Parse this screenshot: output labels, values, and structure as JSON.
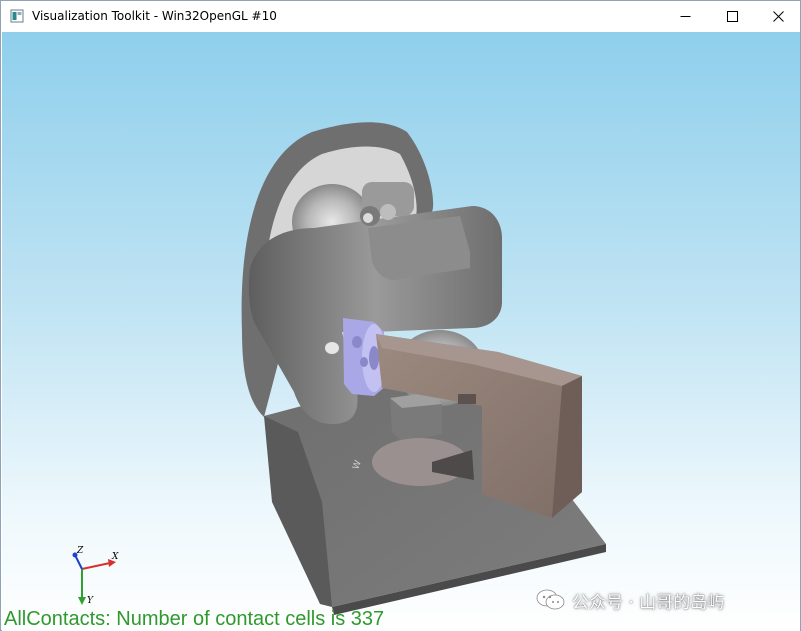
{
  "window": {
    "title": "Visualization Toolkit - Win32OpenGL #10",
    "app_icon": "window-app-icon",
    "controls": {
      "minimize": "minimize-icon",
      "maximize": "maximize-icon",
      "close": "close-icon"
    }
  },
  "viewport": {
    "background_top": "#8fcfec",
    "background_bottom": "#ffffff",
    "status_text": "AllContacts: Number of contact cells is 337",
    "status_color": "#2e9a2e"
  },
  "axes": {
    "x_label": "X",
    "y_label": "Y",
    "z_label": "Z",
    "x_color": "#d83030",
    "y_color": "#30a030",
    "z_color": "#2040d0"
  },
  "watermark": {
    "icon": "wechat-icon",
    "text": "公众号 · 山哥的岛屿"
  },
  "model": {
    "colors": {
      "gray": "#7d7d7d",
      "gray_light": "#b9b9b9",
      "brown": "#8f7d74",
      "lavender": "#a9a7e6"
    }
  }
}
